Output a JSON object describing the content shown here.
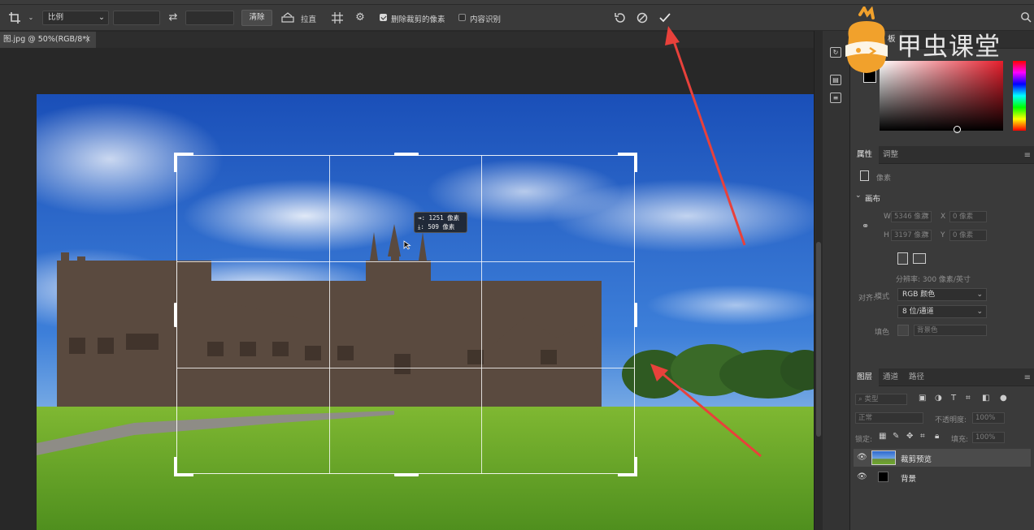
{
  "options_bar": {
    "ratio_select": "比例",
    "clear_button": "清除",
    "straighten_label": "拉直",
    "delete_cropped_label": "删除裁剪的像素",
    "content_aware_label": "内容识别",
    "delete_cropped_checked": true,
    "content_aware_checked": false
  },
  "document": {
    "tab_title": "图.jpg @ 50%(RGB/8*)",
    "tab_close": "×"
  },
  "crop_tooltip": {
    "width_line": "⇥: 1251 像素",
    "height_line": "⤓:  509 像素"
  },
  "watermark": {
    "text": "甲虫课堂",
    "color_panel_tab_fragment": "板"
  },
  "properties": {
    "tabs": [
      "属性",
      "调整"
    ],
    "kind_label": "像素",
    "section_canvas": "画布",
    "w_label": "W",
    "w_value": "5346 像素",
    "w_unit": "₹",
    "h_label": "H",
    "h_value": "3197 像素",
    "h_unit": "₹",
    "x_label": "X",
    "x_value": "0 像素",
    "y_label": "Y",
    "y_value": "0 像素",
    "resolution": "分辨率: 300 像素/英寸",
    "mode_label": "模式",
    "mode_value": "RGB 颜色",
    "align_label": "对齐:",
    "depth_value": "8 位/通道",
    "fill_label": "填色",
    "fill_value": "背景色"
  },
  "layers": {
    "tabs": [
      "图层",
      "通道",
      "路径"
    ],
    "filter_placeholder": "类型",
    "blend_mode": "正常",
    "opacity_label": "不透明度:",
    "opacity_value": "100%",
    "lock_label": "锁定:",
    "fill_label": "填充:",
    "fill_value": "100%",
    "items": [
      {
        "name": "裁剪预览"
      },
      {
        "name": "背景"
      }
    ]
  },
  "colors": {
    "accent_red": "#e8413b",
    "sky_blue": "#1f5fc4",
    "grass_green": "#6ea82d"
  }
}
